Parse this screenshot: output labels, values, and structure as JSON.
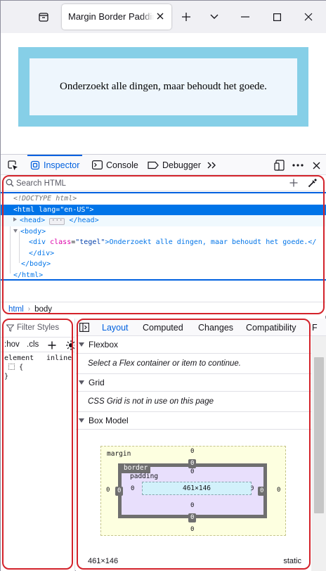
{
  "browser": {
    "tab_title": "Margin Border Padding"
  },
  "page": {
    "tile_text": "Onderzoekt alle dingen, maar behoudt het goede."
  },
  "devtools": {
    "tabs": [
      "Inspector",
      "Console",
      "Debugger"
    ],
    "active_tab": "Inspector",
    "search_placeholder": "Search HTML",
    "markup": {
      "doctype": "<!DOCTYPE html>",
      "html_open_tag": "<html",
      "html_attr": "lang",
      "html_attr_val": "\"en-US\"",
      "html_close_bracket": ">",
      "head_open": "<head>",
      "head_close": "</head>",
      "body_open": "<body>",
      "div_open": "<div",
      "div_attr": "class",
      "div_attr_val": "\"tegel\"",
      "div_text": ">Onderzoekt alle dingen, maar behoudt het goede.</",
      "div_close": "</div>",
      "body_close": "</body>",
      "html_close": "</html>"
    },
    "breadcrumbs": [
      "html",
      "body"
    ]
  },
  "rules": {
    "filter_placeholder": "Filter Styles",
    "hov": ":hov",
    "cls": ".cls",
    "rule_selector": "element",
    "rule_source": "inline",
    "rule_open": "{",
    "rule_close": "}"
  },
  "layout": {
    "tabs": [
      "Layout",
      "Computed",
      "Changes",
      "Compatibility",
      "F"
    ],
    "active_tab": "Layout",
    "sections": {
      "flexbox": {
        "title": "Flexbox",
        "message": "Select a Flex container or item to continue."
      },
      "grid": {
        "title": "Grid",
        "message": "CSS Grid is not in use on this page"
      },
      "box_model": {
        "title": "Box Model"
      }
    },
    "box_model": {
      "margin_label": "margin",
      "border_label": "border",
      "padding_label": "padding",
      "content_size": "461×146",
      "margin_top": "0",
      "margin_right": "0",
      "margin_bottom": "0",
      "margin_left": "0",
      "border_top": "0",
      "border_right": "0",
      "border_bottom": "0",
      "border_left": "0",
      "padding_top": "0",
      "padding_right": "0",
      "padding_bottom": "0",
      "padding_left": "0"
    },
    "footer": {
      "dimensions": "461×146",
      "position": "static"
    }
  },
  "colors": {
    "tile_border": "#86cfe7",
    "tile_fill": "#eef6fd",
    "accent": "#0061e0",
    "highlight": "#d3222a"
  }
}
